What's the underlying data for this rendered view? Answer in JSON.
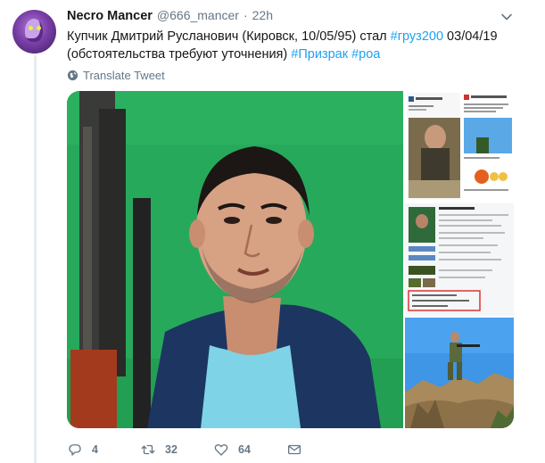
{
  "tweet": {
    "author": {
      "name": "Necro Mancer",
      "handle": "@666_mancer",
      "separator": "·",
      "timestamp": "22h",
      "avatar_icon": "purple-creature-avatar"
    },
    "text_plain_1": "Купчик Дмитрий Русланович (Кировск, 10/05/95) стал ",
    "hashtag_1": "#груз200",
    "text_plain_2": " 03/04/19 (обстоятельства требуют уточнения) ",
    "hashtag_2": "#Призрак",
    "text_plain_3": " ",
    "hashtag_3": "#роа",
    "translate_label": "Translate Tweet"
  },
  "media": {
    "images": [
      "portrait-selfie-with-rifle",
      "social-profile-screenshot",
      "profile-info-screenshot",
      "soldier-on-rocks"
    ]
  },
  "actions": {
    "reply_count": "4",
    "retweet_count": "32",
    "like_count": "64"
  },
  "colors": {
    "link": "#1da1f2",
    "secondary_text": "#657786",
    "primary_text": "#14171a",
    "thread_line": "#e6ecf0"
  }
}
